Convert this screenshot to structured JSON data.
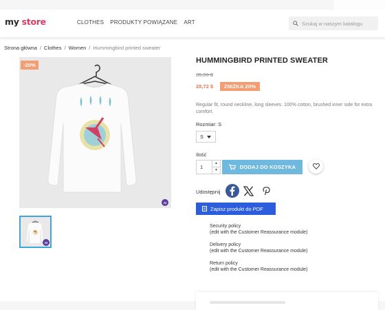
{
  "header": {
    "logo_prefix": "my ",
    "logo_suffix": "store",
    "nav": [
      "CLOTHES",
      "PRODUKTY POWIĄZANE",
      "ART"
    ],
    "search_placeholder": "Szukaj w naszym katalogu"
  },
  "breadcrumb": [
    "Strona główna",
    "Clothes",
    "Women",
    "Hummingbird printed sweater"
  ],
  "gallery": {
    "discount_flag": "-20%",
    "ai_badge": "AI"
  },
  "product": {
    "title": "HUMMINGBIRD PRINTED SWEATER",
    "old_price": "35,90 $",
    "new_price": "28,72 $",
    "discount_label": "ZNIŻKA 20%",
    "description": "Regular fit, round neckline, long sleeves. 100% cotton, brushed inner side for extra comfort.",
    "size_label": "Rozmiar: S",
    "size_value": "S",
    "qty_label": "Ilość",
    "qty_value": "1",
    "add_to_cart": "DODAJ DO KOSZYKA",
    "share_label": "Udostępnij",
    "pdf_button": "Zapisz produkt do PDF"
  },
  "reassurance": [
    {
      "title": "Security policy",
      "note": "(edit with the Customer Reassurance module)"
    },
    {
      "title": "Delivery policy",
      "note": "(edit with the Customer Reassurance module)"
    },
    {
      "title": "Return policy",
      "note": "(edit with the Customer Reassurance module)"
    }
  ],
  "colors": {
    "accent_blue": "#6eb9dd",
    "discount_orange": "#f39d72",
    "pdf_blue": "#2b5ddc",
    "facebook_blue": "#3b5998"
  }
}
